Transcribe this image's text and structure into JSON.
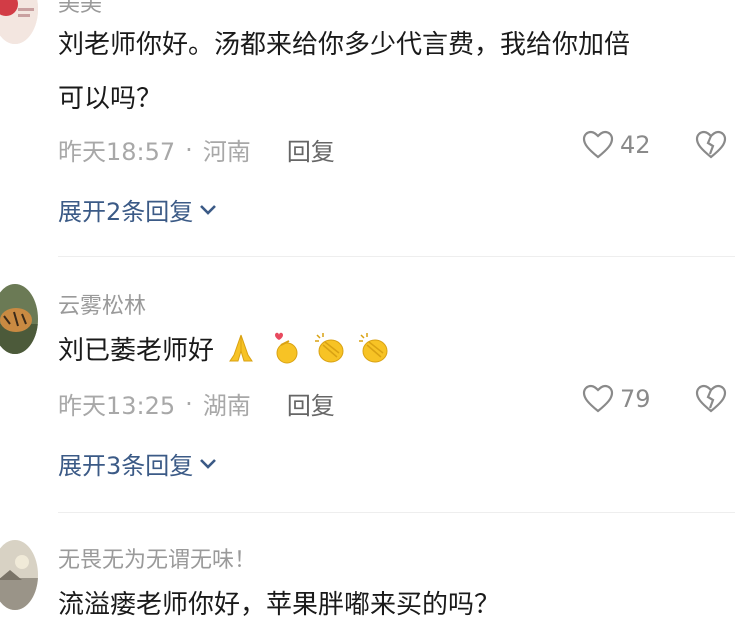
{
  "comments": [
    {
      "username": "美美",
      "text_line1": "刘老师你好。汤都来给你多少代言费，我给你加倍",
      "text_line2": "可以吗？",
      "time": "昨天18:57",
      "sep": "·",
      "location": "河南",
      "reply_label": "回复",
      "likes": "42",
      "expand_label": "展开2条回复"
    },
    {
      "username": "云雾松林",
      "text": "刘已萎老师好",
      "emojis": [
        "folded-hands",
        "finger-heart",
        "clapping-hands",
        "clapping-hands"
      ],
      "time": "昨天13:25",
      "sep": "·",
      "location": "湖南",
      "reply_label": "回复",
      "likes": "79",
      "expand_label": "展开3条回复"
    },
    {
      "username": "无畏无为无谓无味！",
      "text": "流溢瘘老师你好，苹果胖嘟来买的吗？"
    }
  ],
  "colors": {
    "link": "#3b5a86",
    "meta": "#a8a8a8",
    "text": "#1a1a1a",
    "emoji": "#f7c325"
  }
}
